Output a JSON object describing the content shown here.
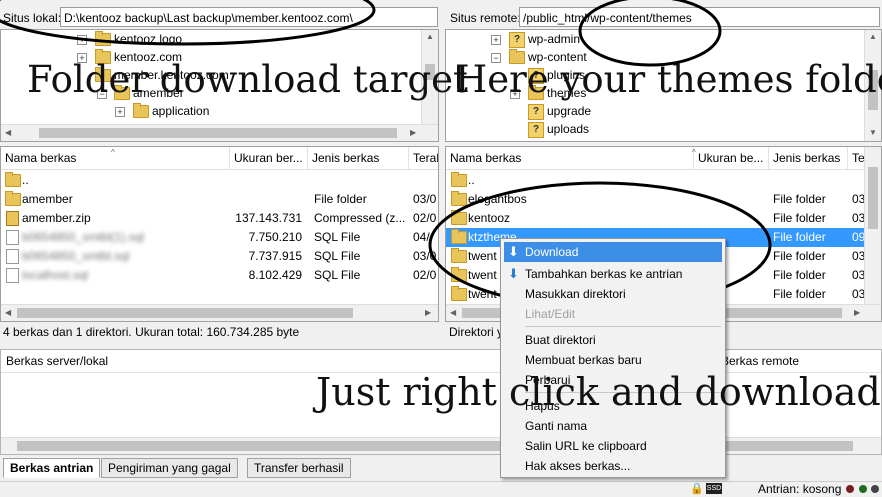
{
  "local_site": {
    "label": "Situs lokal:",
    "path": "D:\\kentooz backup\\Last backup\\member.kentooz.com\\"
  },
  "remote_site": {
    "label": "Situs remote:",
    "path": "/public_html/wp-content/themes"
  },
  "local_tree": [
    "kentooz logo",
    "kentooz.com",
    "member.kentooz.com",
    "amember",
    "application"
  ],
  "remote_tree": [
    "wp-admin",
    "wp-content",
    "plugins",
    "themes",
    "upgrade",
    "uploads"
  ],
  "local_columns": [
    "Nama berkas",
    "Ukuran ber...",
    "Jenis berkas",
    "Teral"
  ],
  "remote_columns": [
    "Nama berkas",
    "Ukuran be...",
    "Jenis berkas",
    "Te"
  ],
  "local_files": [
    {
      "name": "..",
      "size": "",
      "type": "",
      "date": ""
    },
    {
      "name": "amember",
      "size": "",
      "type": "File folder",
      "date": "03/0"
    },
    {
      "name": "amember.zip",
      "size": "137.143.731",
      "type": "Compressed (z...",
      "date": "02/0"
    },
    {
      "name": "b0654850_smtbl(1).sql",
      "size": "7.750.210",
      "type": "SQL File",
      "date": "04/"
    },
    {
      "name": "b0654850_smtbl.sql",
      "size": "7.737.915",
      "type": "SQL File",
      "date": "03/0"
    },
    {
      "name": "localhost.sql",
      "size": "8.102.429",
      "type": "SQL File",
      "date": "02/0"
    }
  ],
  "remote_files": [
    {
      "name": "..",
      "type": "",
      "date": ""
    },
    {
      "name": "elegantbos",
      "type": "File folder",
      "date": "03"
    },
    {
      "name": "kentooz",
      "type": "File folder",
      "date": "03"
    },
    {
      "name": "ktztheme",
      "type": "File folder",
      "date": "09"
    },
    {
      "name": "twent",
      "type": "File folder",
      "date": "03"
    },
    {
      "name": "twent",
      "type": "File folder",
      "date": "03"
    },
    {
      "name": "twent",
      "type": "File folder",
      "date": "03"
    }
  ],
  "local_status": "4 berkas dan 1 direktori. Ukuran total: 160.734.285 byte",
  "remote_status": "Direktori y",
  "queue_header": {
    "left": "Berkas server/lokal",
    "right": "Berkas remote"
  },
  "context_menu": [
    "Download",
    "Tambahkan berkas ke antrian",
    "Masukkan direktori",
    "Lihat/Edit",
    "Buat direktori",
    "Membuat berkas baru",
    "Perbarui",
    "Hapus",
    "Ganti nama",
    "Salin URL ke clipboard",
    "Hak akses berkas..."
  ],
  "tabs": [
    "Berkas antrian",
    "Pengiriman yang gagal",
    "Transfer berhasil"
  ],
  "queue_status": "Antrian: kosong",
  "annotations": {
    "local": "Folder download target",
    "remote": "Here your themes folder",
    "instruction": "Just right click and download"
  },
  "colors": {
    "selection": "#3399ff",
    "menu_highlight": "#3d8ee6",
    "accent_folder": "#e8c55a"
  }
}
